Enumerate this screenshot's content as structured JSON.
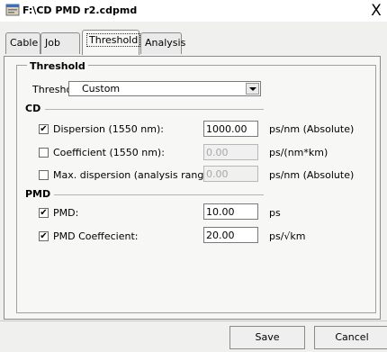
{
  "window": {
    "title": "F:\\CD PMD r2.cdpmd",
    "close_glyph": "X",
    "app_icon": "app-window-icon"
  },
  "tabs": [
    {
      "label": "Cable",
      "active": false
    },
    {
      "label": "Job",
      "active": false
    },
    {
      "label": "Threshold",
      "active": true
    },
    {
      "label": "Analysis",
      "active": false
    }
  ],
  "threshold_group": {
    "title": "Threshold",
    "threshold_label": "Threshold:",
    "threshold_value": "Custom"
  },
  "cd": {
    "section": "CD",
    "rows": [
      {
        "label": "Dispersion (1550 nm):",
        "checked": true,
        "value": "1000.00",
        "unit": "ps/nm  (Absolute)",
        "enabled": true
      },
      {
        "label": "Coefficient (1550 nm):",
        "checked": false,
        "value": "0.00",
        "unit": "ps/(nm*km)",
        "enabled": false
      },
      {
        "label": "Max. dispersion (analysis range):",
        "checked": false,
        "value": "0.00",
        "unit": "ps/nm  (Absolute)",
        "enabled": false
      }
    ]
  },
  "pmd": {
    "section": "PMD",
    "rows": [
      {
        "label": "PMD:",
        "checked": true,
        "value": "10.00",
        "unit": "ps",
        "enabled": true
      },
      {
        "label": "PMD Coeffecient:",
        "checked": true,
        "value": "20.00",
        "unit": "ps/√km",
        "enabled": true
      }
    ]
  },
  "footer": {
    "save_label": "Save",
    "cancel_label": "Cancel"
  },
  "check_glyph": "✔"
}
